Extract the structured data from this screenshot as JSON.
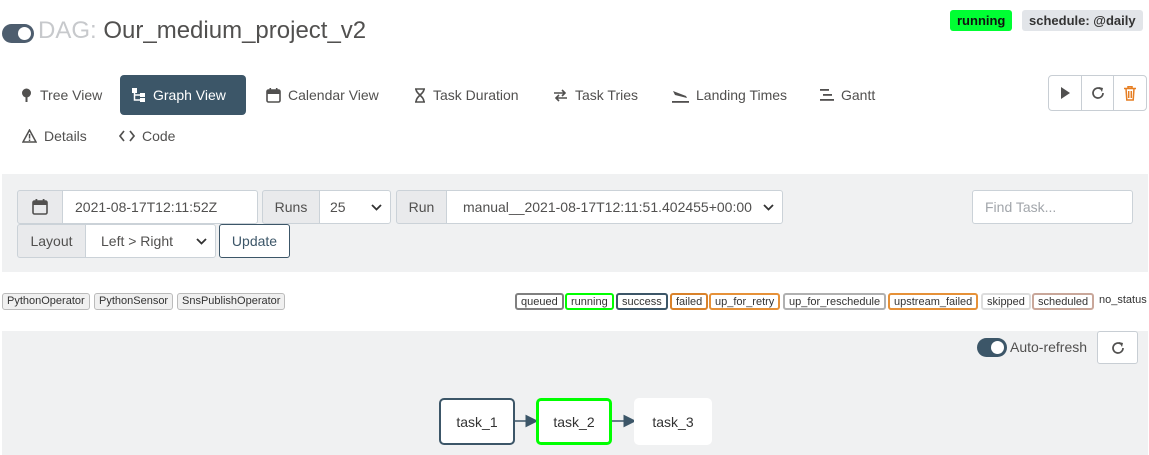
{
  "header": {
    "dag_prefix": "DAG:",
    "dag_id": "Our_medium_project_v2",
    "state_badge": "running",
    "schedule_badge": "schedule: @daily"
  },
  "nav": {
    "tabs": [
      {
        "label": "Tree View",
        "icon": "tree-pin-icon"
      },
      {
        "label": "Graph View",
        "icon": "graph-icon",
        "active": true
      },
      {
        "label": "Calendar View",
        "icon": "calendar-icon"
      },
      {
        "label": "Task Duration",
        "icon": "hourglass-icon"
      },
      {
        "label": "Task Tries",
        "icon": "retry-arrows-icon"
      },
      {
        "label": "Landing Times",
        "icon": "plane-landing-icon"
      },
      {
        "label": "Gantt",
        "icon": "gantt-icon"
      },
      {
        "label": "Details",
        "icon": "warning-triangle-icon"
      },
      {
        "label": "Code",
        "icon": "code-icon"
      }
    ],
    "actions": [
      "play-icon",
      "refresh-icon",
      "trash-icon"
    ]
  },
  "form": {
    "base_date": "2021-08-17T12:11:52Z",
    "runs_label": "Runs",
    "runs_value": "25",
    "run_label": "Run",
    "run_value": "manual__2021-08-17T12:11:51.402455+00:00",
    "layout_label": "Layout",
    "layout_value": "Left > Right",
    "update_label": "Update",
    "find_placeholder": "Find Task..."
  },
  "operators": [
    "PythonOperator",
    "PythonSensor",
    "SnsPublishOperator"
  ],
  "states": [
    {
      "label": "queued",
      "color": "#808080"
    },
    {
      "label": "running",
      "color": "#00ff00"
    },
    {
      "label": "success",
      "color": "#3c5668"
    },
    {
      "label": "failed",
      "color": "#d9822b"
    },
    {
      "label": "up_for_retry",
      "color": "#e69138"
    },
    {
      "label": "up_for_reschedule",
      "color": "#b0b0b0"
    },
    {
      "label": "upstream_failed",
      "color": "#e69138"
    },
    {
      "label": "skipped",
      "color": "#dddddd"
    },
    {
      "label": "scheduled",
      "color": "#c9a79a"
    },
    {
      "label": "no_status",
      "color": "#ffffff"
    }
  ],
  "graph": {
    "auto_refresh_label": "Auto-refresh",
    "nodes": [
      {
        "label": "task_1",
        "state": "success"
      },
      {
        "label": "task_2",
        "state": "running"
      },
      {
        "label": "task_3",
        "state": "no_status"
      }
    ]
  }
}
